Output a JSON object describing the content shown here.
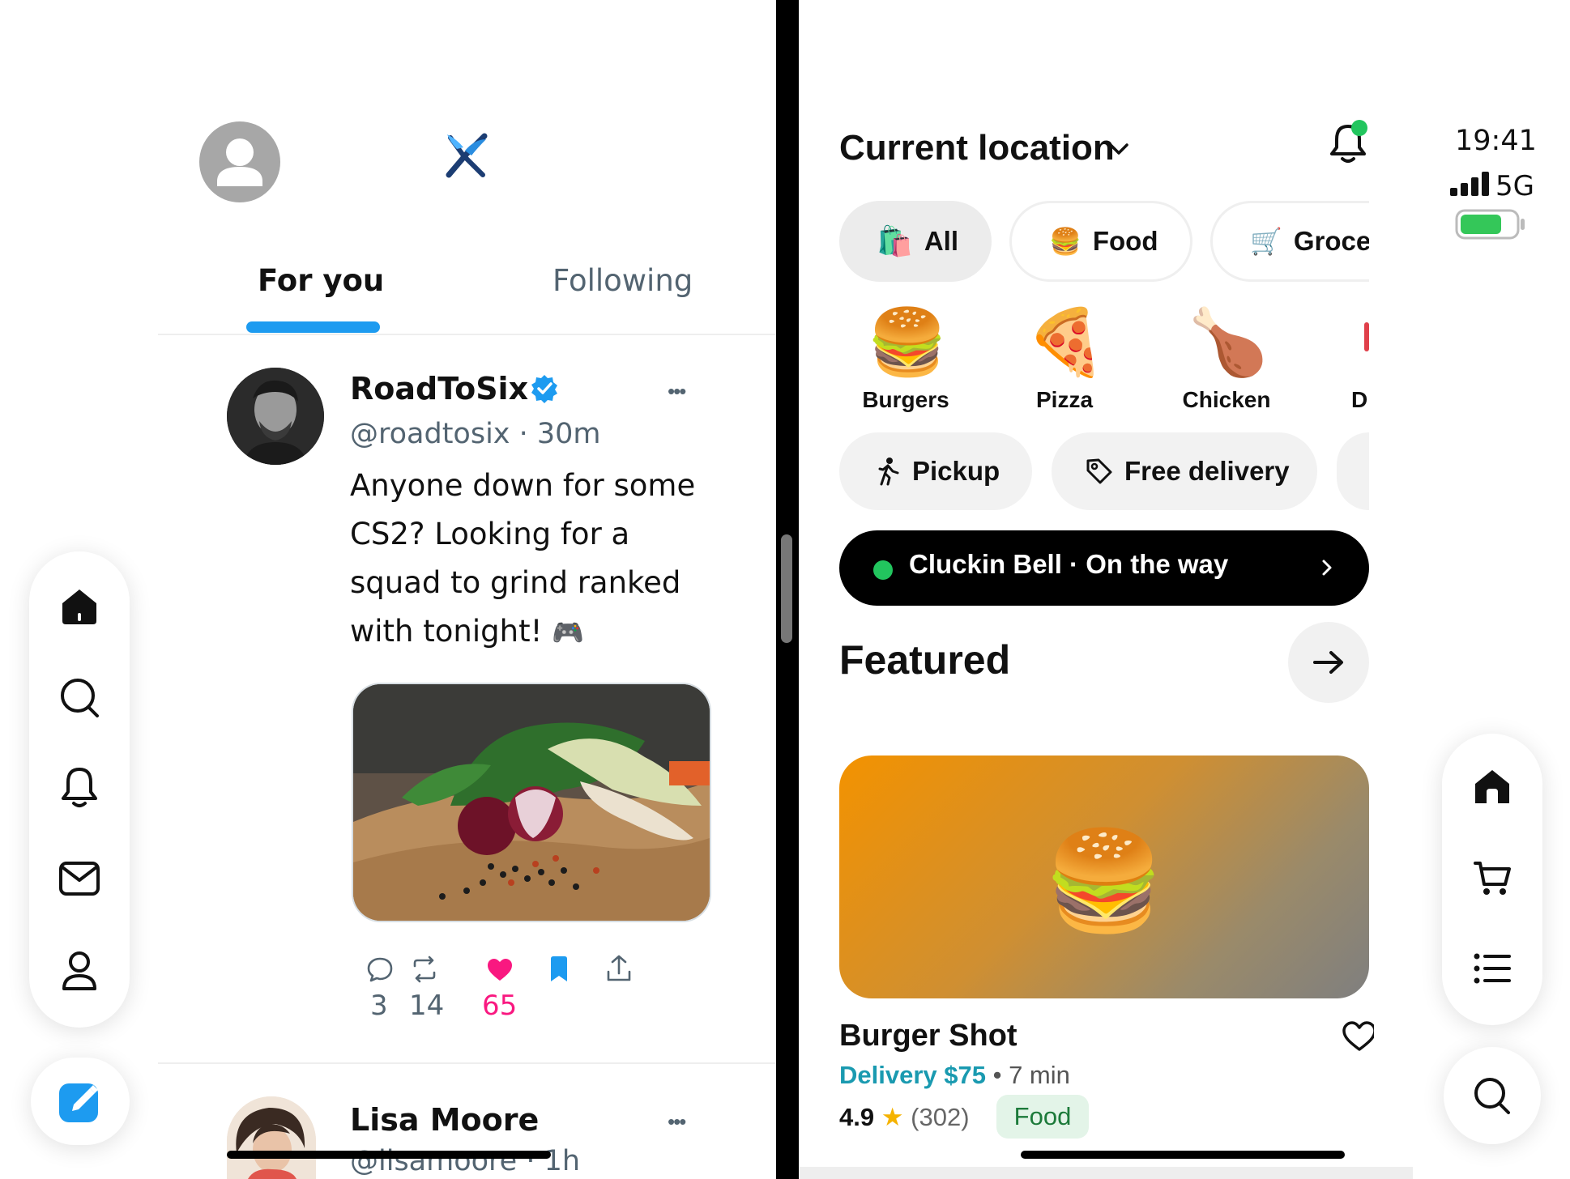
{
  "social": {
    "tabs": [
      {
        "label": "For you",
        "active": true
      },
      {
        "label": "Following",
        "active": false
      }
    ],
    "posts": [
      {
        "name": "RoadToSix",
        "verified": true,
        "handle": "@roadtosix · 30m",
        "text": "Anyone down for some CS2? Looking for a squad to grind ranked with tonight!",
        "emoji": "🎮",
        "stats": {
          "replies": "3",
          "reposts": "14",
          "likes": "65"
        }
      },
      {
        "name": "Lisa Moore",
        "handle": "@lisamoore · 1h"
      }
    ],
    "more_glyph": "•••",
    "nav_icons": [
      "home-icon",
      "search-icon",
      "bell-icon",
      "mail-icon",
      "profile-icon"
    ],
    "accent": "#1d9bf0",
    "like_color": "#f91880"
  },
  "food": {
    "location_title": "Current location",
    "categories_chips": [
      {
        "emoji": "🛍️",
        "label": "All",
        "active": true
      },
      {
        "emoji": "🍔",
        "label": "Food",
        "active": false
      },
      {
        "emoji": "🛒",
        "label": "Groce",
        "active": false
      }
    ],
    "categories": [
      {
        "emoji": "🍔",
        "label": "Burgers"
      },
      {
        "emoji": "🍕",
        "label": "Pizza"
      },
      {
        "emoji": "🍗",
        "label": "Chicken"
      },
      {
        "emoji": "",
        "label": "D"
      }
    ],
    "filters": [
      {
        "icon": "walking-icon",
        "label": "Pickup"
      },
      {
        "icon": "tag-icon",
        "label": "Free delivery"
      }
    ],
    "order_banner": {
      "text": "Cluckin Bell · On the way",
      "status_color": "#22c55e"
    },
    "featured_title": "Featured",
    "restaurant": {
      "name": "Burger Shot",
      "delivery": "Delivery $75",
      "eta": "7 min",
      "rating": "4.9",
      "reviews": "(302)",
      "tag": "Food",
      "emoji": "🍔"
    },
    "nav_icons": [
      "home-icon",
      "cart-icon",
      "list-icon",
      "search-icon"
    ],
    "delivery_color": "#1a9ab0"
  },
  "status_bar": {
    "time": "19:41",
    "network": "5G",
    "battery_color": "#34c759"
  }
}
